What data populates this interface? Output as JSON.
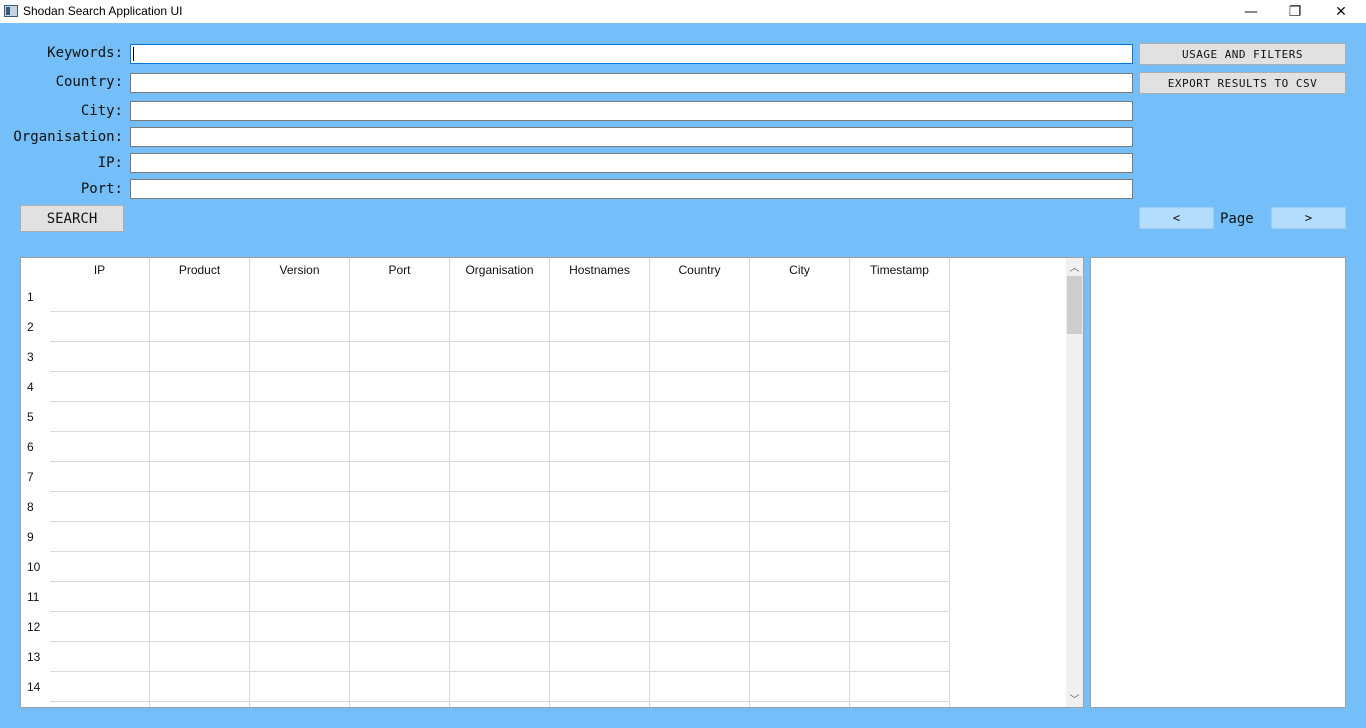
{
  "window": {
    "title": "Shodan Search Application UI",
    "minimize_glyph": "—",
    "maximize_glyph": "❐",
    "close_glyph": "✕"
  },
  "form": {
    "keywords_label": "Keywords:",
    "keywords_value": "",
    "country_label": "Country:",
    "country_value": "",
    "city_label": "City:",
    "city_value": "",
    "organisation_label": "Organisation:",
    "organisation_value": "",
    "ip_label": "IP:",
    "ip_value": "",
    "port_label": "Port:",
    "port_value": ""
  },
  "buttons": {
    "search": "SEARCH",
    "usage_and_filters": "USAGE AND FILTERS",
    "export_csv": "EXPORT RESULTS TO CSV"
  },
  "pager": {
    "prev": "<",
    "label": "Page",
    "next": ">"
  },
  "table": {
    "columns": [
      "IP",
      "Product",
      "Version",
      "Port",
      "Organisation",
      "Hostnames",
      "Country",
      "City",
      "Timestamp"
    ],
    "row_numbers": [
      "1",
      "2",
      "3",
      "4",
      "5",
      "6",
      "7",
      "8",
      "9",
      "10",
      "11",
      "12",
      "13",
      "14"
    ]
  },
  "scrollbar": {
    "up_glyph": "︿",
    "down_glyph": "﹀"
  },
  "colors": {
    "background": "#74bef9",
    "pager_button": "#b3dcfd",
    "button": "#e1e1e1"
  }
}
